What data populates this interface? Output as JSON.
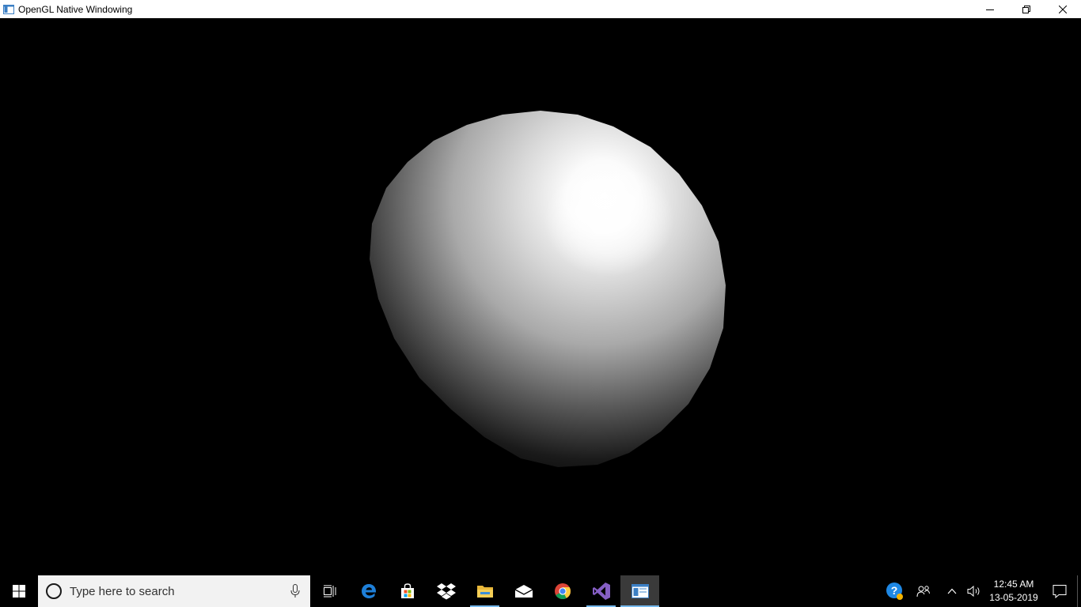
{
  "window": {
    "title": "OpenGL Native Windowing",
    "controls": [
      "minimize-icon",
      "restore-icon",
      "close-icon"
    ]
  },
  "viewport": {
    "background": "#000000",
    "object": "white lit sphere"
  },
  "taskbar": {
    "search_placeholder": "Type here to search",
    "apps": [
      {
        "name": "task-view",
        "running": false
      },
      {
        "name": "edge",
        "running": false
      },
      {
        "name": "microsoft-store",
        "running": false
      },
      {
        "name": "dropbox",
        "running": false
      },
      {
        "name": "file-explorer",
        "running": true
      },
      {
        "name": "mail",
        "running": false
      },
      {
        "name": "chrome",
        "running": false
      },
      {
        "name": "visual-studio",
        "running": true
      },
      {
        "name": "opengl-app",
        "running": true,
        "active": true
      }
    ],
    "clock": {
      "time": "12:45 AM",
      "date": "13-05-2019"
    }
  },
  "colors": {
    "accent": "#76b9ed",
    "taskbar": "#000000",
    "search_bg": "#f2f2f2"
  }
}
